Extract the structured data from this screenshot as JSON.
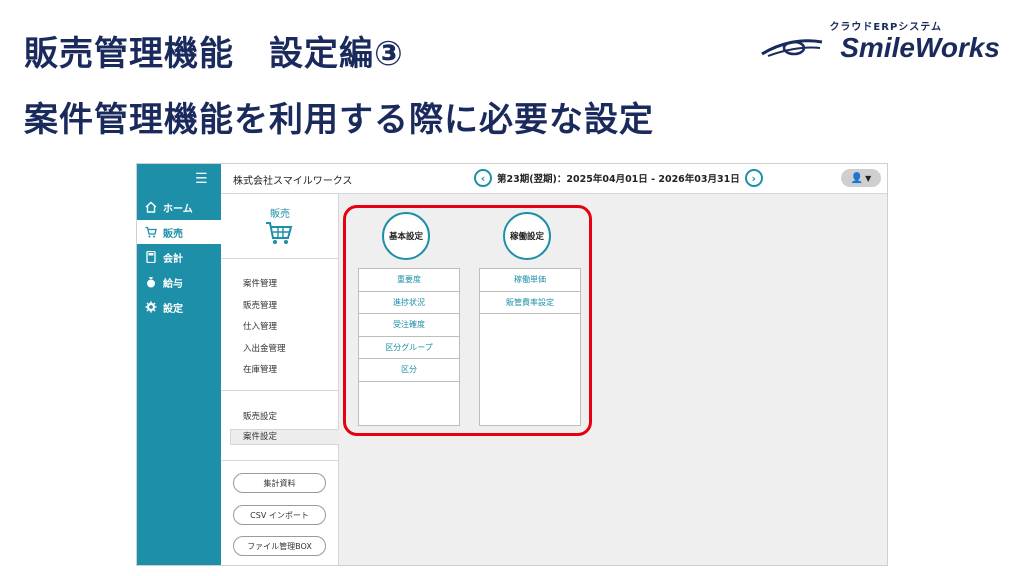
{
  "slide": {
    "title_line1": "販売管理機能　設定編③",
    "title_line2": "案件管理機能を利用する際に必要な設定"
  },
  "logo": {
    "subtitle": "クラウドERPシステム",
    "name": "SmileWorks",
    "color": "#1a2a5c"
  },
  "colors": {
    "accent": "#1d8fa8",
    "highlight": "#e60012"
  },
  "sidebar": {
    "menu_icon": "hamburger-icon",
    "items": [
      {
        "label": "ホーム",
        "icon": "home-icon"
      },
      {
        "label": "販売",
        "icon": "cart-icon",
        "active": true
      },
      {
        "label": "会計",
        "icon": "calculator-icon"
      },
      {
        "label": "給与",
        "icon": "money-bag-icon"
      },
      {
        "label": "設定",
        "icon": "gear-icon"
      }
    ]
  },
  "topbar": {
    "company": "株式会社スマイルワークス",
    "period": "第23期(翌期)：2025年04月01日 - 2026年03月31日",
    "prev_icon": "chevron-left-icon",
    "next_icon": "chevron-right-icon",
    "user_icon": "user-icon"
  },
  "subpanel": {
    "title": "販売",
    "menu": [
      "案件管理",
      "販売管理",
      "仕入管理",
      "入出金管理",
      "在庫管理"
    ],
    "settings": [
      "販売設定",
      "案件設定"
    ],
    "buttons": [
      "集計資料",
      "CSV インポート",
      "ファイル管理BOX"
    ]
  },
  "main": {
    "columns": [
      {
        "title": "基本設定",
        "items": [
          "重要度",
          "進捗状況",
          "受注確度",
          "区分グループ",
          "区分"
        ]
      },
      {
        "title": "稼働設定",
        "items": [
          "稼働単価",
          "販管費率設定"
        ]
      }
    ]
  }
}
